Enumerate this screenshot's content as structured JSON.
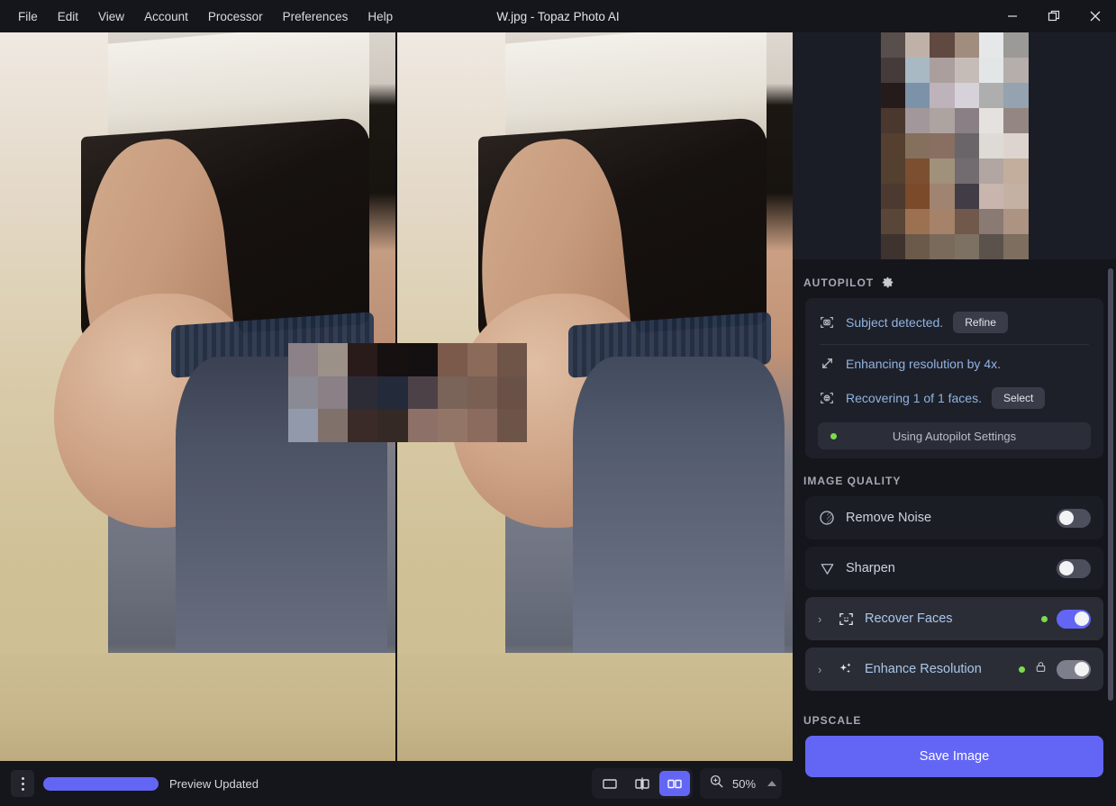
{
  "titlebar": {
    "menus": [
      "File",
      "Edit",
      "View",
      "Account",
      "Processor",
      "Preferences",
      "Help"
    ],
    "title": "W.jpg - Topaz Photo AI",
    "window_controls": [
      {
        "name": "minimize-icon",
        "glyph": "—"
      },
      {
        "name": "restore-icon",
        "glyph": "❐"
      },
      {
        "name": "close-icon",
        "glyph": "✕"
      }
    ]
  },
  "canvas": {
    "view": "side-by-side",
    "censor_colors": [
      "#8b8186",
      "#9c9188",
      "#2a1b1b",
      "#161011",
      "#141012",
      "#7b5a4c",
      "#8c6a59",
      "#6f5448",
      "#898a94",
      "#8a8086",
      "#2b2c36",
      "#232a3a",
      "#4b4147",
      "#7a6358",
      "#7a6053",
      "#6a5148",
      "#9299ab",
      "#80716a",
      "#3a2b28",
      "#352926",
      "#8d7067",
      "#937567",
      "#8a6b5e",
      "#6d5449"
    ]
  },
  "bottombar": {
    "overflow_menu": "kebab-menu-icon",
    "progress_percent": 100,
    "status": "Preview Updated",
    "view_modes": [
      {
        "name": "single-view",
        "active": false
      },
      {
        "name": "split-view",
        "active": false
      },
      {
        "name": "side-by-side-view",
        "active": true
      }
    ],
    "zoom": {
      "icon": "zoom-icon",
      "value": "50%",
      "caret": "caret-up-icon"
    }
  },
  "sidebar": {
    "thumbnail": {
      "name": "preview-thumbnail",
      "pixels": [
        "#584e4c",
        "#c0b1a8",
        "#5f4940",
        "#a08d7d",
        "#e6e7e8",
        "#9b9a96",
        "#453b3a",
        "#a8b9c4",
        "#ab9f9e",
        "#c6bcb7",
        "#e2e6e7",
        "#b5aeab",
        "#261b1b",
        "#7c92a9",
        "#beb3ba",
        "#d6d2da",
        "#aeaeae",
        "#95a2b0",
        "#4a372e",
        "#a2979a",
        "#ada3a1",
        "#897f84",
        "#e5e1de",
        "#948783",
        "#55402f",
        "#85705e",
        "#896e62",
        "#6a6569",
        "#dedad6",
        "#ded4cf",
        "#54402f",
        "#7c4f30",
        "#a0917a",
        "#726c70",
        "#b2a6a3",
        "#c3ae9e",
        "#4c3a30",
        "#7a4a2a",
        "#a08370",
        "#413c46",
        "#c8b5ad",
        "#c4b1a4",
        "#5a4539",
        "#9c7152",
        "#a68268",
        "#70594a",
        "#8a7a74",
        "#ac9382",
        "#3e332e",
        "#6b594a",
        "#7a6a5c",
        "#7d7163",
        "#5b524c",
        "#7d6e60"
      ]
    },
    "autopilot": {
      "heading": "AUTOPILOT",
      "gear_icon": "gear-icon",
      "subject": {
        "icon": "subject-detect-icon",
        "text": "Subject detected.",
        "button": "Refine"
      },
      "resolution": {
        "icon": "resize-arrow-icon",
        "text": "Enhancing resolution by 4x."
      },
      "faces": {
        "icon": "face-detect-icon",
        "text_prefix": "Recovering ",
        "text_count": "1 of 1",
        "text_suffix": " faces.",
        "full_text": "Recovering 1 of 1 faces.",
        "button": "Select"
      },
      "settings_button": {
        "label": "Using Autopilot Settings",
        "status_dot_color": "#7bdc4e"
      }
    },
    "image_quality": {
      "heading": "IMAGE QUALITY",
      "items": [
        {
          "label": "Remove Noise",
          "icon": "noise-circle-icon",
          "enabled": false,
          "expandable": false,
          "dot": false,
          "locked": false
        },
        {
          "label": "Sharpen",
          "icon": "sharpen-triangle-icon",
          "enabled": false,
          "expandable": false,
          "dot": false,
          "locked": false
        },
        {
          "label": "Recover Faces",
          "icon": "face-smile-icon",
          "enabled": true,
          "expandable": true,
          "dot": true,
          "locked": false
        },
        {
          "label": "Enhance Resolution",
          "icon": "sparkles-icon",
          "enabled": true,
          "expandable": true,
          "dot": true,
          "locked": true
        }
      ]
    },
    "upscale": {
      "heading": "UPSCALE",
      "save_label": "Save Image"
    }
  },
  "colors": {
    "accent": "#6366f5",
    "status_green": "#7bdc4e",
    "sidebar_bg": "#15161c",
    "card_bg": "#1e2029"
  }
}
